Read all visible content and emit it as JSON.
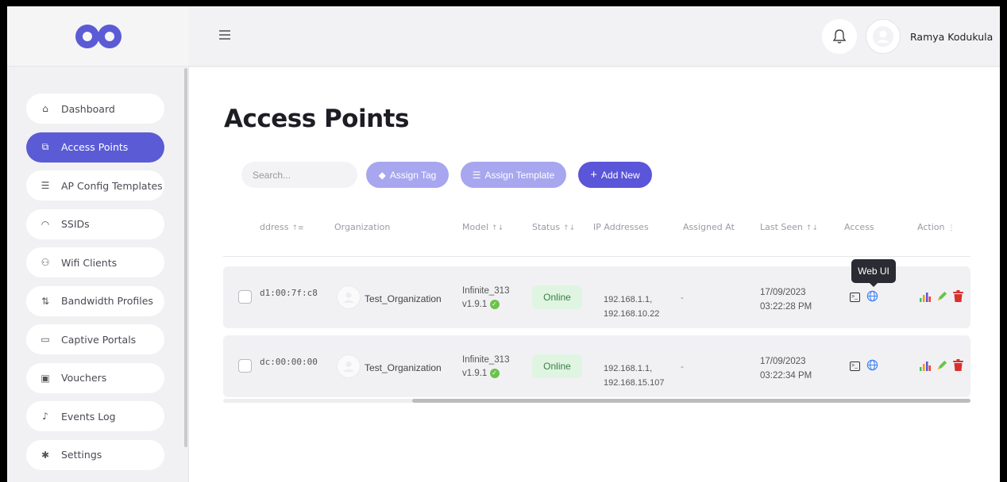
{
  "header": {
    "username": "Ramya Kodukula"
  },
  "sidebar": {
    "items": [
      {
        "label": "Dashboard",
        "icon": "home-icon",
        "glyph": "⌂",
        "active": false
      },
      {
        "label": "Access Points",
        "icon": "access-point-icon",
        "glyph": "⧉",
        "active": true
      },
      {
        "label": "AP Config Templates",
        "icon": "config-list-icon",
        "glyph": "☰",
        "active": false
      },
      {
        "label": "SSIDs",
        "icon": "wifi-icon",
        "glyph": "◠",
        "active": false
      },
      {
        "label": "Wifi Clients",
        "icon": "network-icon",
        "glyph": "⚇",
        "active": false
      },
      {
        "label": "Bandwidth Profiles",
        "icon": "arrows-updown-icon",
        "glyph": "⇅",
        "active": false
      },
      {
        "label": "Captive Portals",
        "icon": "monitor-icon",
        "glyph": "▭",
        "active": false
      },
      {
        "label": "Vouchers",
        "icon": "voucher-icon",
        "glyph": "▣",
        "active": false
      },
      {
        "label": "Events Log",
        "icon": "bell-icon",
        "glyph": "♪",
        "active": false
      },
      {
        "label": "Settings",
        "icon": "gear-icon",
        "glyph": "✱",
        "active": false
      }
    ]
  },
  "main": {
    "title": "Access Points",
    "search_placeholder": "Search...",
    "buttons": {
      "assign_tag": "Assign Tag",
      "assign_template": "Assign Template",
      "add_new": "Add New"
    },
    "columns": [
      "ddress",
      "Organization",
      "Model",
      "Status",
      "IP Addresses",
      "Assigned At",
      "Last Seen",
      "Access",
      "Action"
    ],
    "rows": [
      {
        "mac": "d1:00:7f:c8",
        "organization": "Test_Organization",
        "model": "Infinite_313",
        "version": "v1.9.1",
        "status": "Online",
        "ip1": "192.168.1.1,",
        "ip2": "192.168.10.22",
        "assigned_at": "-",
        "last_seen_date": "17/09/2023",
        "last_seen_time": "03:22:28 PM"
      },
      {
        "mac": "dc:00:00:00",
        "organization": "Test_Organization",
        "model": "Infinite_313",
        "version": "v1.9.1",
        "status": "Online",
        "ip1": "192.168.1.1,",
        "ip2": "192.168.15.107",
        "assigned_at": "-",
        "last_seen_date": "17/09/2023",
        "last_seen_time": "03:22:34 PM"
      }
    ],
    "tooltip": "Web UI"
  },
  "colors": {
    "accent": "#5a55d9",
    "accent_light": "#a7a6ef",
    "online_bg": "#dff5e1",
    "online_text": "#3a7d44",
    "delete": "#d9302c",
    "edit": "#6cc24a"
  }
}
